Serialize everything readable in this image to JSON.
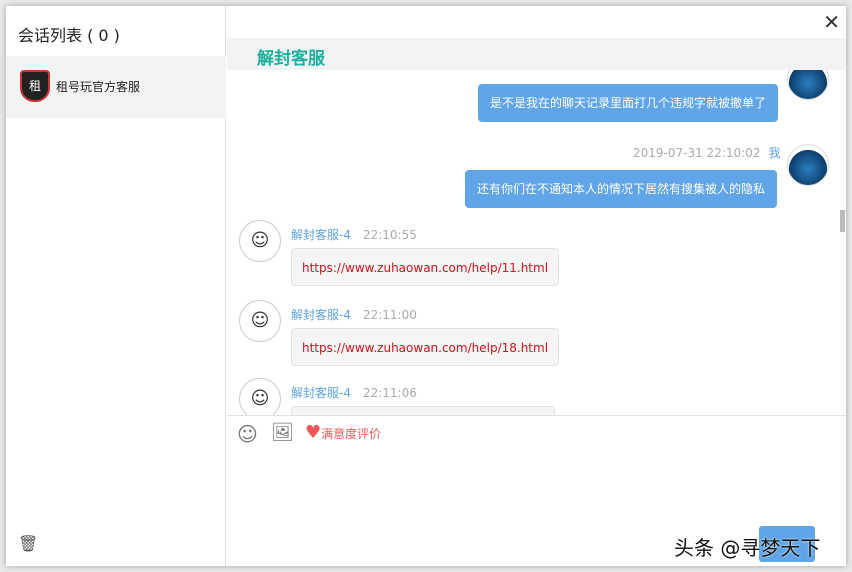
{
  "sidebar": {
    "title": "会话列表 ( 0 )",
    "conversations": [
      {
        "name": "租号玩官方客服",
        "logo_text": "租"
      }
    ]
  },
  "header": {
    "title": "解封客服"
  },
  "messages": [
    {
      "side": "right",
      "text": "是不是我在的聊天记录里面打几个违规字就被撤单了"
    },
    {
      "side": "right",
      "time": "2019-07-31 22:10:02",
      "sender": "我",
      "text": "还有你们在不通知本人的情况下居然有搜集被人的隐私"
    },
    {
      "side": "left",
      "sender": "解封客服-4",
      "time": "22:10:55",
      "text": "https://www.zuhaowan.com/help/11.html"
    },
    {
      "side": "left",
      "sender": "解封客服-4",
      "time": "22:11:00",
      "text": "https://www.zuhaowan.com/help/18.html"
    },
    {
      "side": "left",
      "sender": "解封客服-4",
      "time": "22:11:06",
      "text": ""
    }
  ],
  "toolbar": {
    "rating_label": "满意度评价"
  },
  "watermark": "头条 @寻梦天下",
  "colors": {
    "accent": "#1fb19e",
    "bubble": "#5fa5e8",
    "link": "#d0121b"
  }
}
